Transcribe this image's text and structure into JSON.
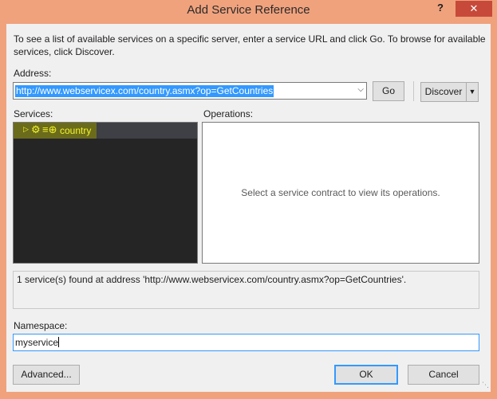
{
  "window": {
    "title": "Add Service Reference",
    "help_label": "?",
    "close_label": "✕"
  },
  "intro": "To see a list of available services on a specific server, enter a service URL and click Go. To browse for available services, click Discover.",
  "address": {
    "label": "Address:",
    "value": "http://www.webservicex.com/country.asmx?op=GetCountries"
  },
  "buttons": {
    "go": "Go",
    "discover": "Discover",
    "advanced": "Advanced...",
    "ok": "OK",
    "cancel": "Cancel"
  },
  "services": {
    "label": "Services:",
    "items": [
      {
        "name": "country"
      }
    ]
  },
  "operations": {
    "label": "Operations:",
    "hint": "Select a service contract to view its operations."
  },
  "status": "1 service(s) found at address 'http://www.webservicex.com/country.asmx?op=GetCountries'.",
  "namespace": {
    "label": "Namespace:",
    "value": "myservice"
  },
  "colors": {
    "highlight": "#f3f32a",
    "selection": "#3399ff",
    "tree_background": "#252526"
  }
}
